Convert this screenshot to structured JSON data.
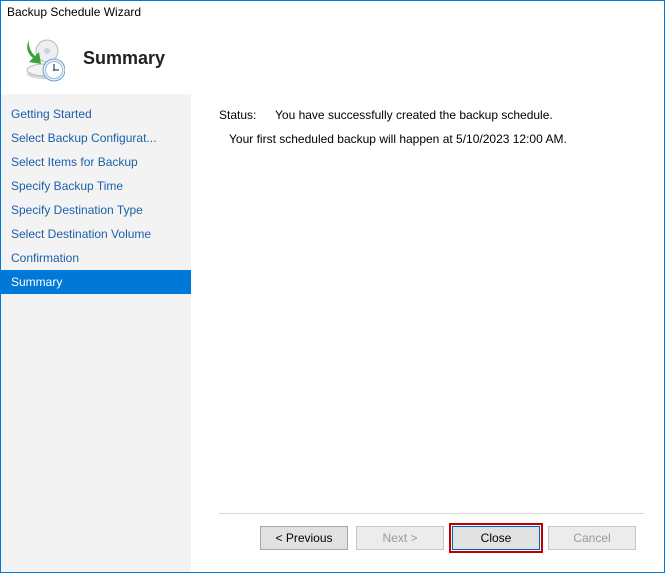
{
  "window": {
    "title": "Backup Schedule Wizard"
  },
  "header": {
    "page_title": "Summary"
  },
  "sidebar": {
    "steps": [
      {
        "label": "Getting Started"
      },
      {
        "label": "Select Backup Configurat..."
      },
      {
        "label": "Select Items for Backup"
      },
      {
        "label": "Specify Backup Time"
      },
      {
        "label": "Specify Destination Type"
      },
      {
        "label": "Select Destination Volume"
      },
      {
        "label": "Confirmation"
      },
      {
        "label": "Summary"
      }
    ],
    "current_index": 7
  },
  "content": {
    "status_label": "Status:",
    "status_value": "You have successfully created the backup schedule.",
    "message": "Your first scheduled backup will happen at 5/10/2023 12:00 AM."
  },
  "buttons": {
    "previous": "< Previous",
    "next": "Next >",
    "close": "Close",
    "cancel": "Cancel"
  }
}
